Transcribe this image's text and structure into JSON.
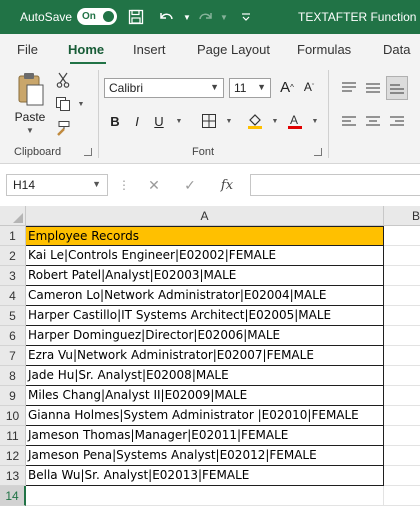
{
  "titlebar": {
    "autosave_label": "AutoSave",
    "autosave_state": "On",
    "document_title": "TEXTAFTER Function",
    "accent": "#217346"
  },
  "ribbon_tabs": [
    "File",
    "Home",
    "Insert",
    "Page Layout",
    "Formulas",
    "Data"
  ],
  "active_tab": "Home",
  "clipboard": {
    "paste_label": "Paste",
    "group_label": "Clipboard"
  },
  "font_group": {
    "font_name": "Calibri",
    "font_size": "11",
    "group_label": "Font",
    "bold": "B",
    "italic": "I",
    "underline": "U"
  },
  "formula_bar": {
    "name_box": "H14",
    "formula": ""
  },
  "columns": [
    "A",
    "B"
  ],
  "rows": [
    {
      "n": "1",
      "text": "Employee Records"
    },
    {
      "n": "2",
      "text": "Kai Le|Controls Engineer|E02002|FEMALE"
    },
    {
      "n": "3",
      "text": "Robert Patel|Analyst|E02003|MALE"
    },
    {
      "n": "4",
      "text": "Cameron Lo|Network Administrator|E02004|MALE"
    },
    {
      "n": "5",
      "text": "Harper Castillo|IT Systems Architect|E02005|MALE"
    },
    {
      "n": "6",
      "text": "Harper Dominguez|Director|E02006|MALE"
    },
    {
      "n": "7",
      "text": "Ezra Vu|Network Administrator|E02007|FEMALE"
    },
    {
      "n": "8",
      "text": "Jade Hu|Sr. Analyst|E02008|MALE"
    },
    {
      "n": "9",
      "text": "Miles Chang|Analyst II|E02009|MALE"
    },
    {
      "n": "10",
      "text": "Gianna Holmes|System Administrator |E02010|FEMALE"
    },
    {
      "n": "11",
      "text": "Jameson Thomas|Manager|E02011|FEMALE"
    },
    {
      "n": "12",
      "text": "Jameson Pena|Systems Analyst|E02012|FEMALE"
    },
    {
      "n": "13",
      "text": "Bella Wu|Sr. Analyst|E02013|FEMALE"
    },
    {
      "n": "14",
      "text": ""
    }
  ],
  "header_fill": "#ffc000"
}
